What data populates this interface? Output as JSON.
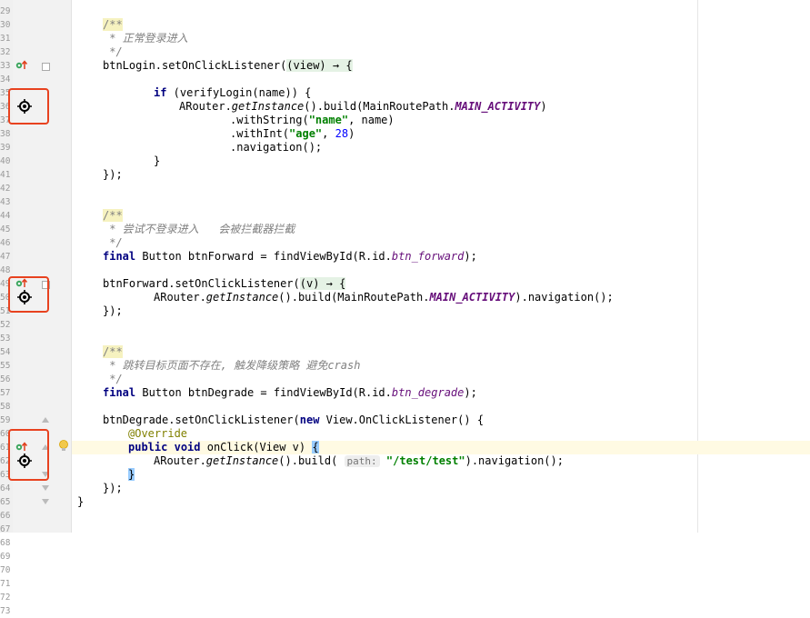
{
  "editor": {
    "line_numbers": [
      "29",
      "30",
      "31",
      "32",
      "33",
      "34",
      "35",
      "36",
      "37",
      "38",
      "39",
      "40",
      "41",
      "42",
      "43",
      "44",
      "45",
      "46",
      "47",
      "48",
      "49",
      "50",
      "51",
      "52",
      "53",
      "54",
      "55",
      "56",
      "57",
      "58",
      "59",
      "60",
      "61",
      "62",
      "63",
      "64",
      "65",
      "66",
      "67",
      "68",
      "69",
      "70",
      "71",
      "72",
      "73"
    ],
    "code": {
      "l1_comment_open": "/**",
      "l2_comment": " * 正常登录进入",
      "l3_comment_close": " */",
      "l4_a": "btnLogin.setOnClickListener(",
      "l4_lambda": "(view) → {",
      "l6_if": "if",
      "l6_rest": " (verifyLogin(name)) {",
      "l7_a": "ARouter.",
      "l7_getinstance": "getInstance",
      "l7_b": "().build(MainRoutePath.",
      "l7_const": "MAIN_ACTIVITY",
      "l7_c": ")",
      "l8_a": ".withString(",
      "l8_str": "\"name\"",
      "l8_b": ", name)",
      "l9_a": ".withInt(",
      "l9_str": "\"age\"",
      "l9_b": ", ",
      "l9_num": "28",
      "l9_c": ")",
      "l10": ".navigation();",
      "l11": "}",
      "l12": "});",
      "l15_comment_open": "/**",
      "l16_comment": " * 尝试不登录进入   会被拦截器拦截",
      "l17_comment_close": " */",
      "l18_final": "final",
      "l18_a": " Button btnForward = findViewById(R.id.",
      "l18_field": "btn_forward",
      "l18_b": ");",
      "l20_a": "btnForward.setOnClickListener(",
      "l20_lambda": "(v) → {",
      "l21_a": "ARouter.",
      "l21_getinstance": "getInstance",
      "l21_b": "().build(MainRoutePath.",
      "l21_const": "MAIN_ACTIVITY",
      "l21_c": ").navigation();",
      "l22": "});",
      "l25_comment_open": "/**",
      "l26_comment_a": " * 跳转目标页面不存在, 触发降级策略 避免",
      "l26_comment_b": "crash",
      "l27_comment_close": " */",
      "l28_final": "final",
      "l28_a": " Button btnDegrade = findViewById(R.id.",
      "l28_field": "btn_degrade",
      "l28_b": ");",
      "l30_a": "btnDegrade.setOnClickListener(",
      "l30_new": "new",
      "l30_b": " View.OnClickListener() {",
      "l31_anno": "@Override",
      "l32_public": "public",
      "l32_void": "void",
      "l32_a": " onClick(View v) ",
      "l32_brace": "{",
      "l33_a": "ARouter.",
      "l33_getinstance": "getInstance",
      "l33_b": "().build( ",
      "l33_hint": "path:",
      "l33_str": "\"/test/test\"",
      "l33_c": ").navigation();",
      "l34_brace": "}",
      "l35": "});",
      "l36": "}"
    }
  },
  "gutter_icons": {
    "implement_icon": "implement-marker-icon",
    "navigate_icon": "route-target-icon",
    "bulb_icon": "lightbulb-icon"
  },
  "colors": {
    "highlight_box": "#e8421f",
    "keyword": "#000080",
    "string": "#008000",
    "comment": "#808080"
  }
}
